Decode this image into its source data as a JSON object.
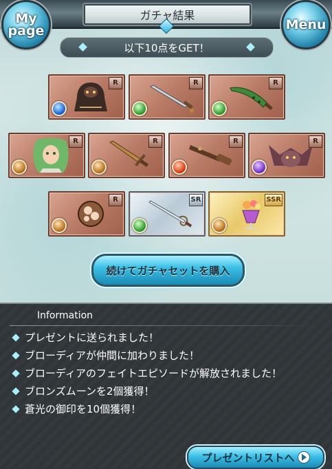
{
  "header": {
    "title": "ガチャ結果",
    "mypage_label": "My page",
    "menu_label": "Menu"
  },
  "banner": {
    "text": "以下10点をGET！"
  },
  "cards": [
    {
      "rarity": "R",
      "element": "water",
      "art": "robe-icon"
    },
    {
      "rarity": "R",
      "element": "wind",
      "art": "sword-icon"
    },
    {
      "rarity": "R",
      "element": "wind",
      "art": "spiked-blade-icon"
    },
    {
      "rarity": "R",
      "element": "earth",
      "art": "character-portrait"
    },
    {
      "rarity": "R",
      "element": "earth",
      "art": "dagger-icon"
    },
    {
      "rarity": "R",
      "element": "fire",
      "art": "gun-icon"
    },
    {
      "rarity": "R",
      "element": "dark",
      "art": "monster-portrait"
    },
    {
      "rarity": "R",
      "element": "earth",
      "art": "gauntlet-icon"
    },
    {
      "rarity": "SR",
      "element": "wind",
      "art": "rapier-icon"
    },
    {
      "rarity": "SSR",
      "element": "earth",
      "art": "drink-icon"
    }
  ],
  "buy_button": {
    "label": "続けてガチャセットを購入"
  },
  "information": {
    "title": "Information",
    "items": [
      "プレゼントに送られました！",
      "ブローディアが仲間に加わりました！",
      "ブローディアのフェイトエピソードが解放されました！",
      "ブロンズムーンを2個獲得！",
      "蒼光の御印を10個獲得！"
    ]
  },
  "present_button": {
    "label": "プレゼントリストへ"
  }
}
